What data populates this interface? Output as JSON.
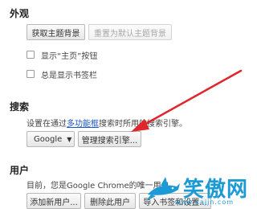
{
  "appearance": {
    "title": "外观",
    "get_themes_button": "获取主题背景",
    "reset_theme_button": "重置为默认主题背景",
    "show_home_checkbox": "显示“主页”按钮",
    "bookmarks_bar_checkbox": "总是显示书签栏"
  },
  "search": {
    "title": "搜索",
    "desc_prefix": "设置在通过",
    "desc_link": "多功能框",
    "desc_suffix": "搜索时所用的搜索引擎。",
    "engine_select": "Google",
    "manage_button": "管理搜索引擎..."
  },
  "users": {
    "title": "用户",
    "desc": "目前，您是Google Chrome的唯一用户。",
    "add_button": "添加新用户...",
    "delete_button": "删除此用户",
    "import_button": "导入书签和设置..."
  },
  "annotation": {
    "arrow_color": "#e0262d"
  },
  "watermark": {
    "name": "笑傲网",
    "domain": "www.xajjn.com",
    "color": "#1c9ad6"
  },
  "icons": {
    "dropdown": "caret-down-icon",
    "checkbox": "checkbox-icon",
    "annotation": "red-arrow-annotation",
    "logo": "shark-logo-icon"
  }
}
